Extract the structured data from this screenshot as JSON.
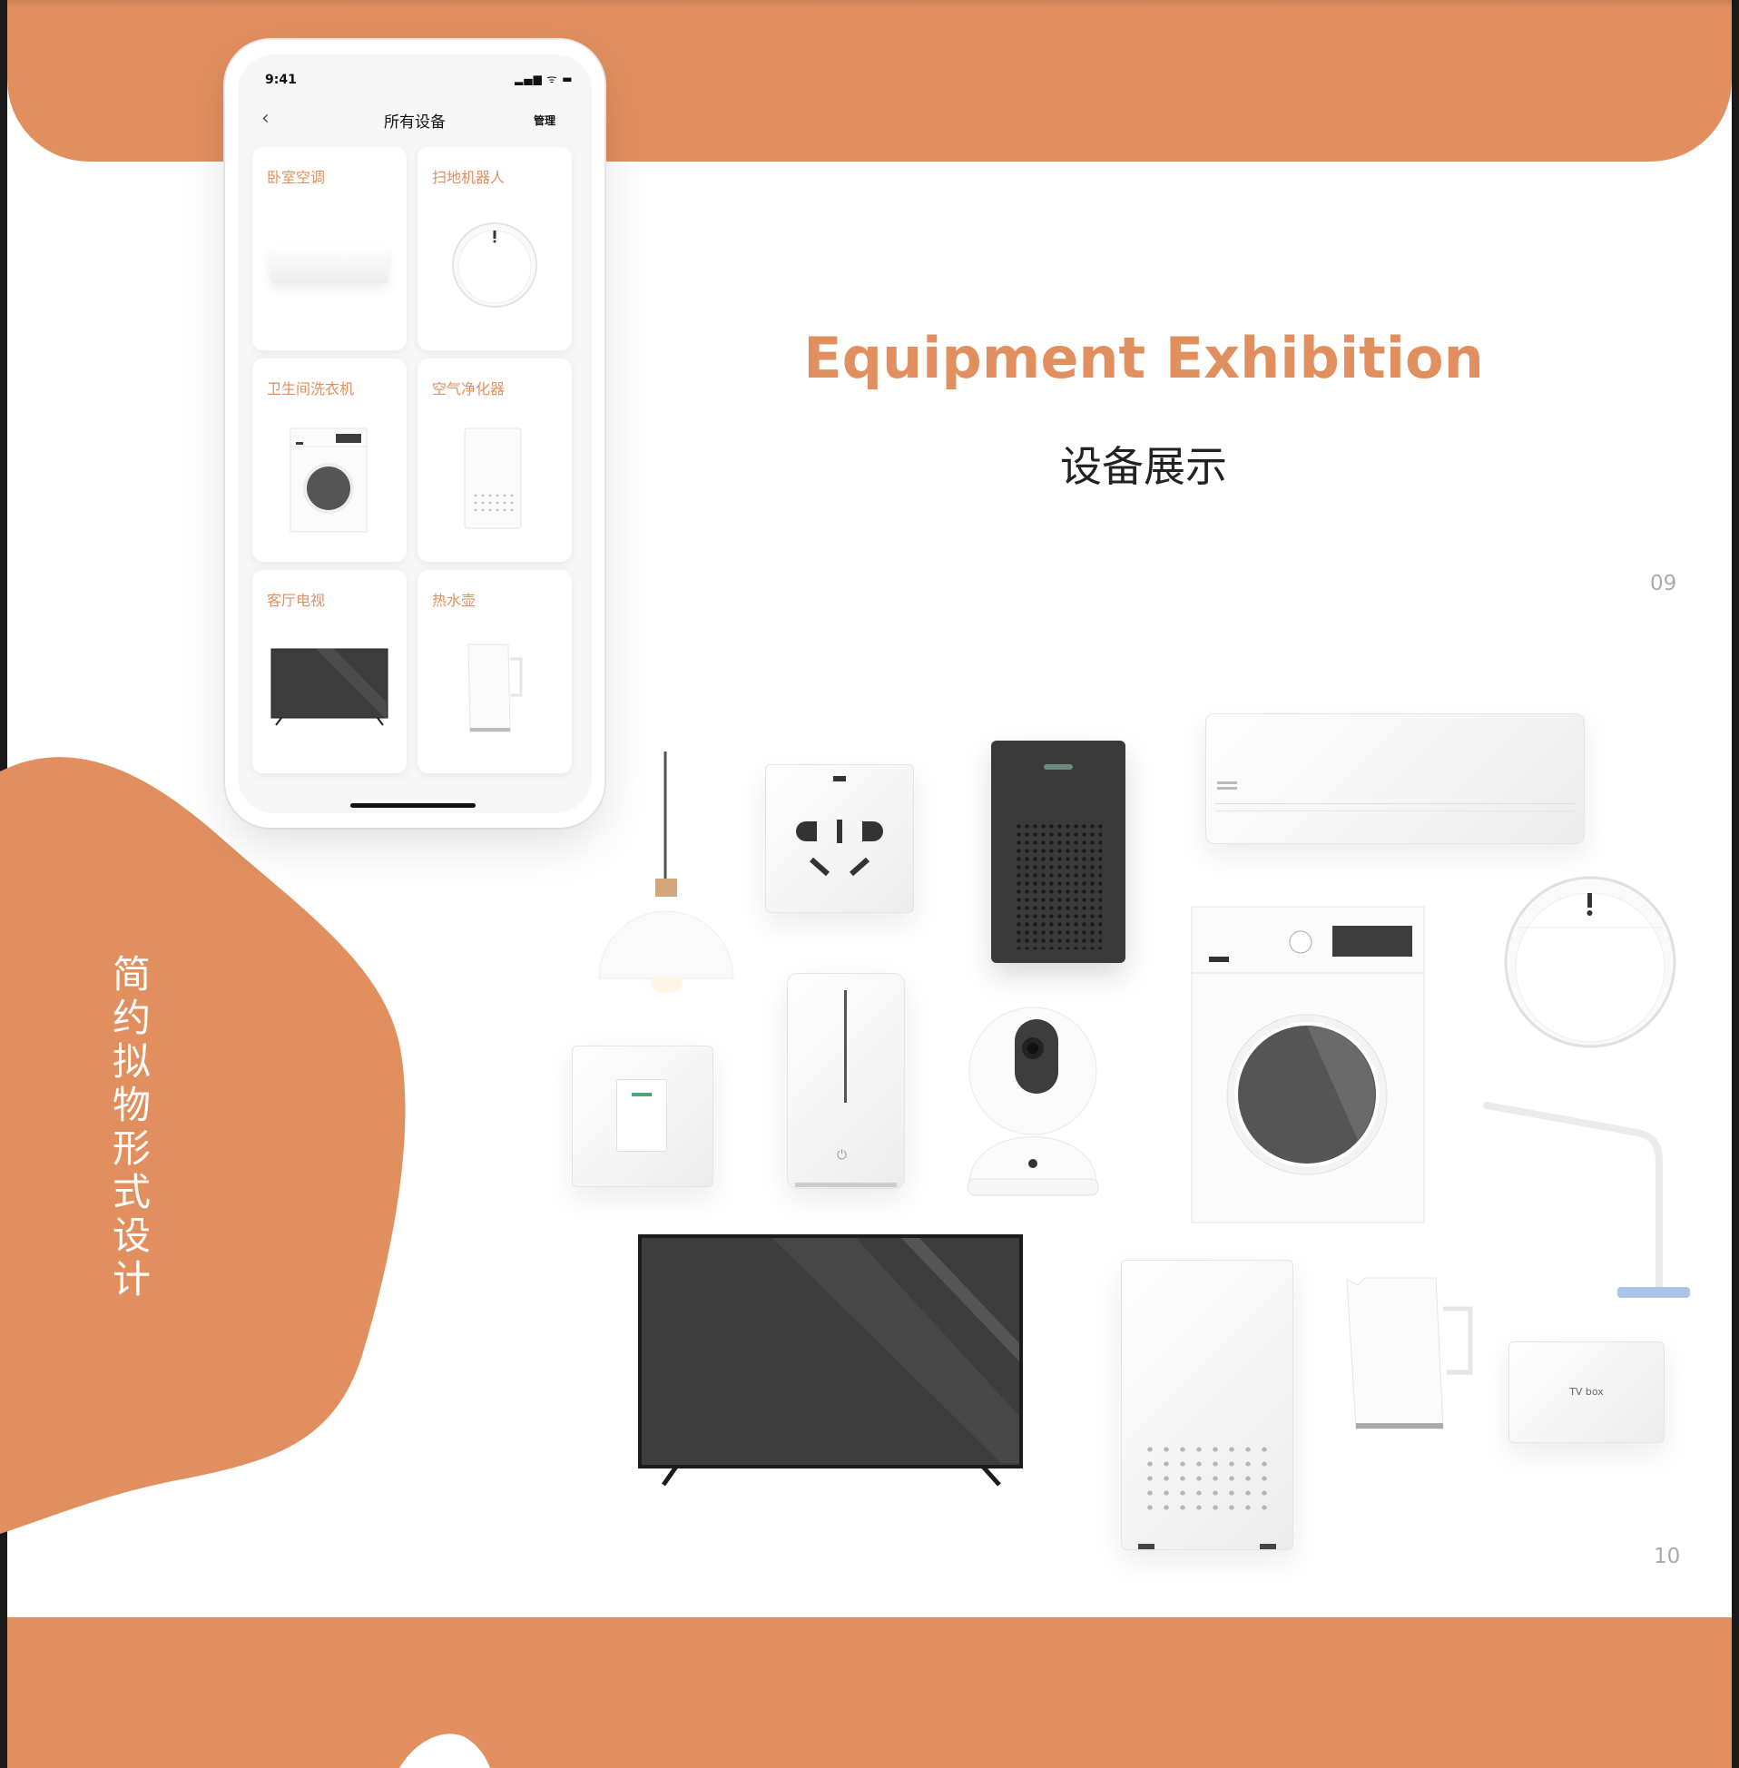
{
  "heading": {
    "en": "Equipment Exhibition",
    "cn": "设备展示"
  },
  "vertical_title": [
    "简",
    "约",
    "拟",
    "物",
    "形",
    "式",
    "设",
    "计"
  ],
  "pages": {
    "top": "09",
    "bottom": "10"
  },
  "phone": {
    "status_time": "9:41",
    "status_icons": "▂▄▆ ᯤ ▬",
    "nav_title": "所有设备",
    "nav_manage": "管理",
    "back_icon": "‹",
    "cards": [
      {
        "label": "卧室空调",
        "device": "air-conditioner"
      },
      {
        "label": "扫地机器人",
        "device": "robot-vacuum"
      },
      {
        "label": "卫生间洗衣机",
        "device": "washing-machine"
      },
      {
        "label": "空气净化器",
        "device": "air-purifier"
      },
      {
        "label": "客厅电视",
        "device": "television"
      },
      {
        "label": "热水壶",
        "device": "kettle"
      }
    ]
  },
  "tv_box_label": "TV  box",
  "colors": {
    "accent": "#e18f5f",
    "dark": "#3d3d3d",
    "text": "#222222",
    "muted": "#aaaaaa"
  }
}
